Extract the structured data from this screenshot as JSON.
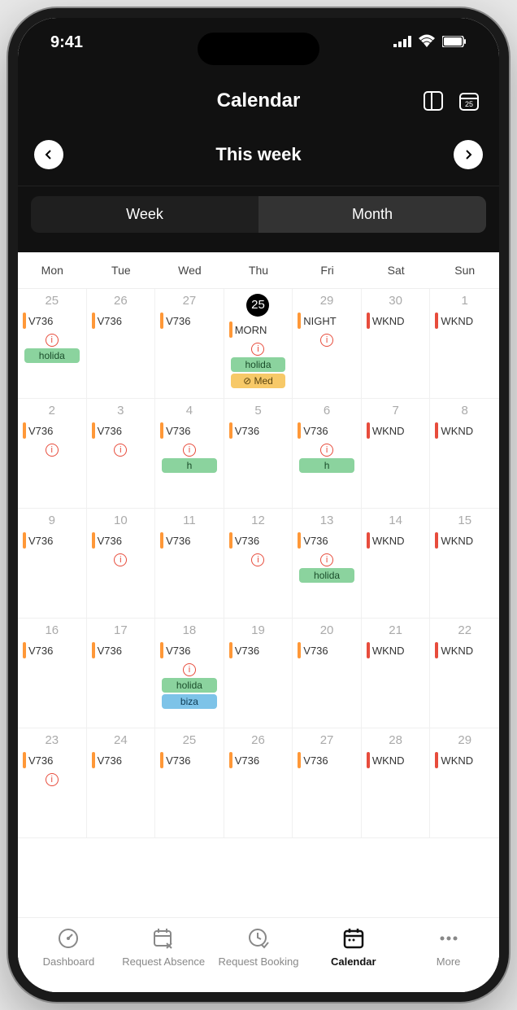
{
  "statusbar": {
    "time": "9:41"
  },
  "header": {
    "title": "Calendar"
  },
  "nav": {
    "title": "This week"
  },
  "segment": {
    "week": "Week",
    "month": "Month"
  },
  "days": [
    "Mon",
    "Tue",
    "Wed",
    "Thu",
    "Fri",
    "Sat",
    "Sun"
  ],
  "cells": [
    {
      "n": "25",
      "shift": "V736",
      "bar": "orange",
      "info": true,
      "tags": [
        {
          "t": "holida",
          "c": "green"
        }
      ]
    },
    {
      "n": "26",
      "shift": "V736",
      "bar": "orange"
    },
    {
      "n": "27",
      "shift": "V736",
      "bar": "orange"
    },
    {
      "n": "25",
      "today": true,
      "shift": "MORN",
      "bar": "orange",
      "info": true,
      "tags": [
        {
          "t": "holida",
          "c": "green"
        },
        {
          "t": "⊘ Med",
          "c": "yellow"
        }
      ]
    },
    {
      "n": "29",
      "shift": "NIGHT",
      "bar": "orange",
      "info": true
    },
    {
      "n": "30",
      "shift": "WKND",
      "bar": "red"
    },
    {
      "n": "1",
      "shift": "WKND",
      "bar": "red"
    },
    {
      "n": "2",
      "shift": "V736",
      "bar": "orange",
      "info": true
    },
    {
      "n": "3",
      "shift": "V736",
      "bar": "orange",
      "info": true
    },
    {
      "n": "4",
      "shift": "V736",
      "bar": "orange",
      "info": true,
      "tags": [
        {
          "t": "h",
          "c": "green"
        }
      ]
    },
    {
      "n": "5",
      "shift": "V736",
      "bar": "orange"
    },
    {
      "n": "6",
      "shift": "V736",
      "bar": "orange",
      "info": true,
      "tags": [
        {
          "t": "h",
          "c": "green"
        }
      ]
    },
    {
      "n": "7",
      "shift": "WKND",
      "bar": "red"
    },
    {
      "n": "8",
      "shift": "WKND",
      "bar": "red"
    },
    {
      "n": "9",
      "shift": "V736",
      "bar": "orange"
    },
    {
      "n": "10",
      "shift": "V736",
      "bar": "orange",
      "info": true
    },
    {
      "n": "11",
      "shift": "V736",
      "bar": "orange"
    },
    {
      "n": "12",
      "shift": "V736",
      "bar": "orange",
      "info": true
    },
    {
      "n": "13",
      "shift": "V736",
      "bar": "orange",
      "info": true,
      "tags": [
        {
          "t": "holida",
          "c": "green"
        }
      ]
    },
    {
      "n": "14",
      "shift": "WKND",
      "bar": "red"
    },
    {
      "n": "15",
      "shift": "WKND",
      "bar": "red"
    },
    {
      "n": "16",
      "shift": "V736",
      "bar": "orange"
    },
    {
      "n": "17",
      "shift": "V736",
      "bar": "orange"
    },
    {
      "n": "18",
      "shift": "V736",
      "bar": "orange",
      "info": true,
      "tags": [
        {
          "t": "holida",
          "c": "green"
        },
        {
          "t": "biza",
          "c": "blue"
        }
      ]
    },
    {
      "n": "19",
      "shift": "V736",
      "bar": "orange"
    },
    {
      "n": "20",
      "shift": "V736",
      "bar": "orange"
    },
    {
      "n": "21",
      "shift": "WKND",
      "bar": "red"
    },
    {
      "n": "22",
      "shift": "WKND",
      "bar": "red"
    },
    {
      "n": "23",
      "shift": "V736",
      "bar": "orange",
      "info": true
    },
    {
      "n": "24",
      "shift": "V736",
      "bar": "orange"
    },
    {
      "n": "25",
      "shift": "V736",
      "bar": "orange"
    },
    {
      "n": "26",
      "shift": "V736",
      "bar": "orange"
    },
    {
      "n": "27",
      "shift": "V736",
      "bar": "orange"
    },
    {
      "n": "28",
      "shift": "WKND",
      "bar": "red"
    },
    {
      "n": "29",
      "shift": "WKND",
      "bar": "red"
    }
  ],
  "bottomnav": {
    "dashboard": "Dashboard",
    "absence": "Request Absence",
    "booking": "Request Booking",
    "calendar": "Calendar",
    "more": "More"
  }
}
